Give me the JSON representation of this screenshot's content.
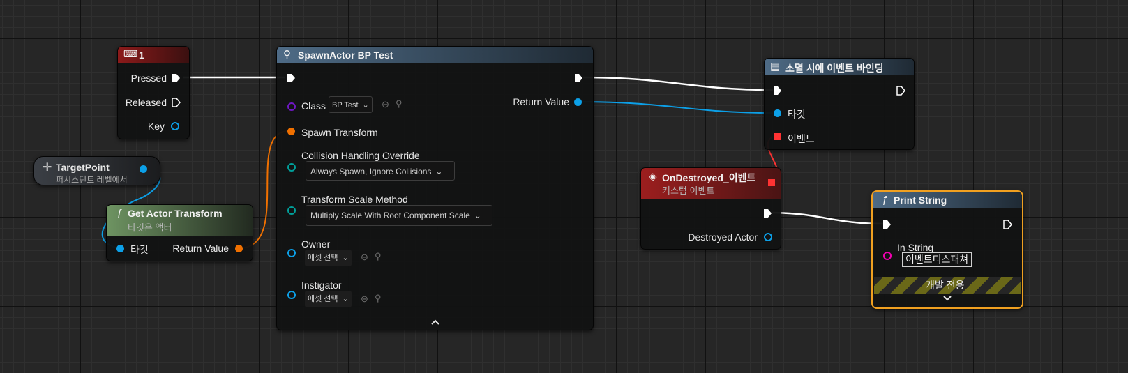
{
  "nodes": {
    "key_input": {
      "title": "1",
      "pressed": "Pressed",
      "released": "Released",
      "key": "Key"
    },
    "target_point": {
      "title": "TargetPoint",
      "subtitle": "퍼시스턴트 레벨에서"
    },
    "get_actor_transform": {
      "title": "Get Actor Transform",
      "subtitle": "타깃은 액터",
      "target": "타깃",
      "return_value": "Return Value",
      "icon": "ƒ"
    },
    "spawn_actor": {
      "title": "SpawnActor BP Test",
      "class_label": "Class",
      "class_value": "BP Test",
      "return_value": "Return Value",
      "spawn_transform": "Spawn Transform",
      "collision_label": "Collision Handling Override",
      "collision_value": "Always Spawn, Ignore Collisions",
      "scale_label": "Transform Scale Method",
      "scale_value": "Multiply Scale With Root Component Scale",
      "owner_label": "Owner",
      "owner_value": "에셋 선택",
      "instigator_label": "Instigator",
      "instigator_value": "에셋 선택",
      "collapse_icon": "chevron-up-icon"
    },
    "bind_event": {
      "title": "소멸 시에 이벤트 바인딩",
      "target": "타깃",
      "event": "이벤트"
    },
    "on_destroyed": {
      "title": "OnDestroyed_이벤트",
      "subtitle": "커스텀 이벤트",
      "destroyed_actor": "Destroyed Actor"
    },
    "print_string": {
      "title": "Print String",
      "in_string_label": "In String",
      "in_string_value": "이벤트디스패쳐",
      "dev_only": "개발 전용",
      "icon": "ƒ",
      "expand_icon": "chevron-down-icon"
    }
  },
  "colors": {
    "exec": "#ffffff",
    "object_pin": "#0ca0e8",
    "transform_pin": "#f07000",
    "class_pin": "#6f17c4",
    "struct_pin": "#00a09a",
    "string_pin": "#f000b0",
    "delegate_pin": "#ff3333",
    "selection": "#f0a020"
  }
}
